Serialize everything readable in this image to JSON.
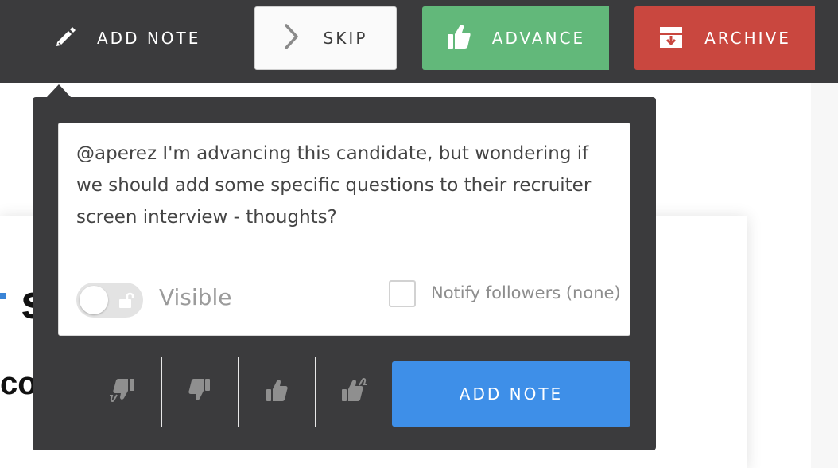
{
  "toolbar": {
    "add_note_label": "ADD NOTE",
    "skip_label": "SKIP",
    "advance_label": "ADVANCE",
    "archive_label": "ARCHIVE",
    "background_color": "#3b3b3d",
    "advance_color": "#62b87a",
    "archive_color": "#c9473f",
    "icons": {
      "add_note": "pencil-icon",
      "skip": "chevron-right-icon",
      "advance": "thumbs-up-icon",
      "archive": "archive-box-icon"
    }
  },
  "background": {
    "heading_fragment": "s",
    "subheading_fragment": "co"
  },
  "note_popover": {
    "note_text": "@aperez I'm advancing this candidate, but wondering if we should add some specific questions to their recruiter screen interview - thoughts?",
    "visibility_toggle": {
      "state": "off",
      "icon": "unlock-icon"
    },
    "visible_label": "Visible",
    "notify_checked": false,
    "notify_label": "Notify followers (none)",
    "ratings": [
      {
        "name": "strong-no",
        "icon": "double-thumbs-down-icon"
      },
      {
        "name": "no",
        "icon": "thumbs-down-icon"
      },
      {
        "name": "yes",
        "icon": "thumbs-up-icon"
      },
      {
        "name": "strong-yes",
        "icon": "double-thumbs-up-icon"
      }
    ],
    "submit_label": "ADD NOTE",
    "submit_color": "#3e8fe8"
  }
}
